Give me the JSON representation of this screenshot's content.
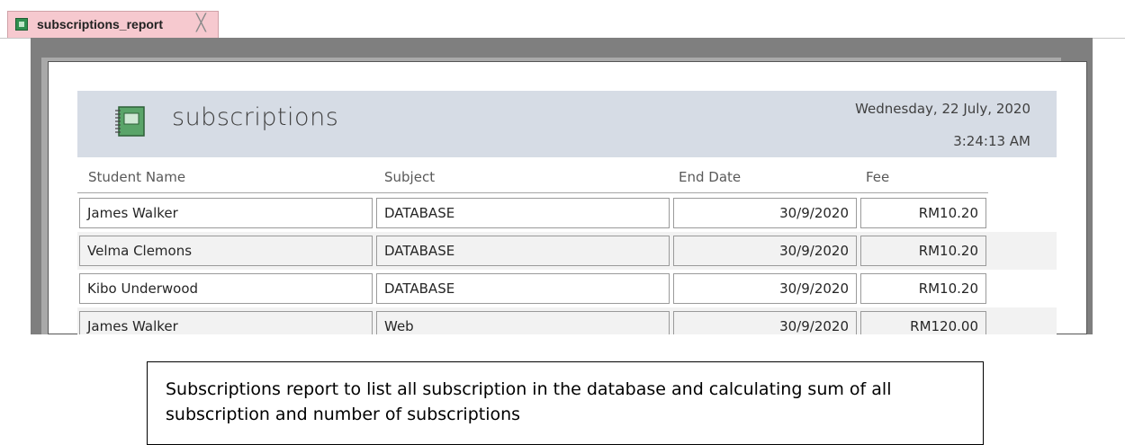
{
  "tab": {
    "label": "subscriptions_report",
    "close_glyph": "╳"
  },
  "report": {
    "title": "subscriptions",
    "date": "Wednesday, 22 July, 2020",
    "time": "3:24:13 AM",
    "columns": [
      "Student Name",
      "Subject",
      "End Date",
      "Fee"
    ],
    "rows": [
      [
        "James Walker",
        "DATABASE",
        "30/9/2020",
        "RM10.20"
      ],
      [
        "Velma Clemons",
        "DATABASE",
        "30/9/2020",
        "RM10.20"
      ],
      [
        "Kibo Underwood",
        "DATABASE",
        "30/9/2020",
        "RM10.20"
      ],
      [
        "James Walker",
        "Web",
        "30/9/2020",
        "RM120.00"
      ]
    ]
  },
  "caption": "Subscriptions report to list all subscription in the database and calculating sum of all subscription and number of subscriptions",
  "colors": {
    "tab_bg": "#f6c9cf",
    "header_band": "#d6dce5",
    "alt_row": "#f2f2f2",
    "canvas_gray": "#7f7f7f"
  },
  "icons": {
    "tab_icon": "report-icon",
    "report_icon": "notebook-icon",
    "close_icon": "close-icon"
  }
}
